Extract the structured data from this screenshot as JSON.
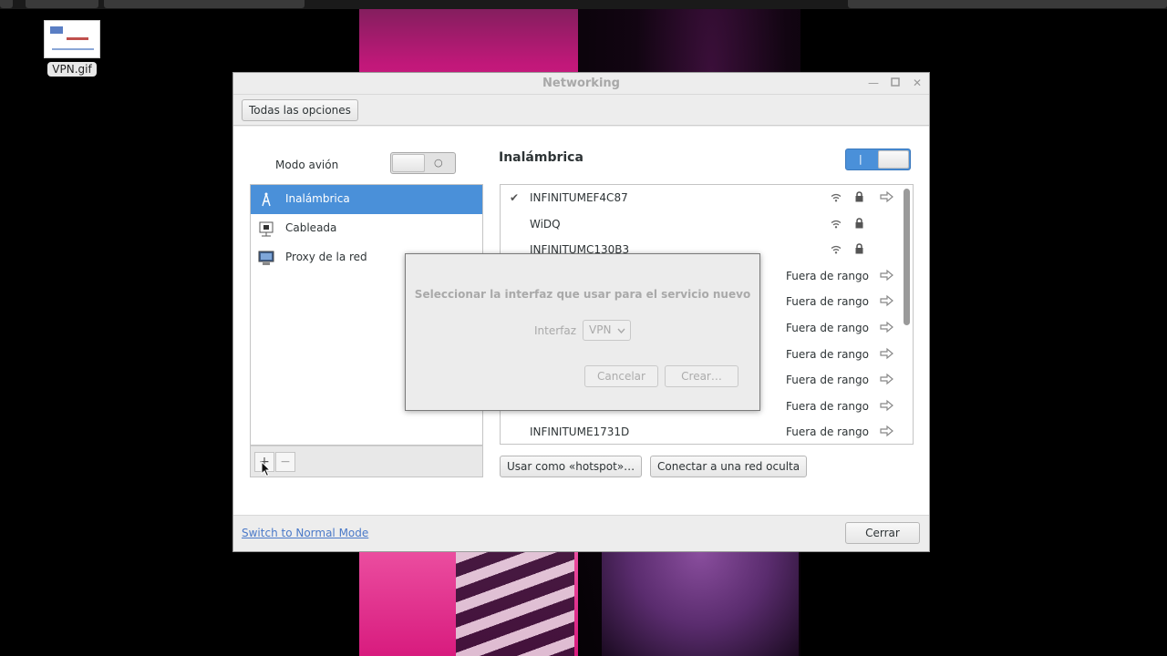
{
  "desktop": {
    "icon_label": "VPN.gif"
  },
  "window": {
    "title": "Networking",
    "all_options_label": "Todas las opciones"
  },
  "sidebar": {
    "airplane_mode_label": "Modo avión",
    "items": [
      {
        "label": "Inalámbrica",
        "icon": "wifi-tower-icon",
        "selected": true
      },
      {
        "label": "Cableada",
        "icon": "wired-network-icon",
        "selected": false
      },
      {
        "label": "Proxy de la red",
        "icon": "proxy-monitor-icon",
        "selected": false
      }
    ],
    "add_label": "+",
    "remove_label": "−"
  },
  "wireless": {
    "heading": "Inalámbrica",
    "networks": [
      {
        "name": "INFINITUMEF4C87",
        "connected": true,
        "status": ""
      },
      {
        "name": "WiDQ",
        "connected": false,
        "status": ""
      },
      {
        "name": "INFINITUMC130B3",
        "connected": false,
        "status": ""
      },
      {
        "name": "",
        "connected": false,
        "status": "Fuera de rango"
      },
      {
        "name": "",
        "connected": false,
        "status": "Fuera de rango"
      },
      {
        "name": "",
        "connected": false,
        "status": "Fuera de rango"
      },
      {
        "name": "",
        "connected": false,
        "status": "Fuera de rango"
      },
      {
        "name": "",
        "connected": false,
        "status": "Fuera de rango"
      },
      {
        "name": "",
        "connected": false,
        "status": "Fuera de rango"
      },
      {
        "name": "INFINITUME1731D",
        "connected": false,
        "status": "Fuera de rango"
      }
    ],
    "hotspot_label": "Usar como «hotspot»…",
    "hidden_network_label": "Conectar a una red oculta"
  },
  "footer": {
    "mode_link": "Switch to Normal Mode",
    "close_label": "Cerrar"
  },
  "dialog": {
    "title": "Seleccionar la interfaz que usar para el servicio nuevo",
    "interface_label": "Interfaz",
    "interface_value": "VPN",
    "cancel_label": "Cancelar",
    "create_label": "Crear…"
  },
  "colors": {
    "accent": "#4a90d9",
    "link": "#4a79c8"
  }
}
